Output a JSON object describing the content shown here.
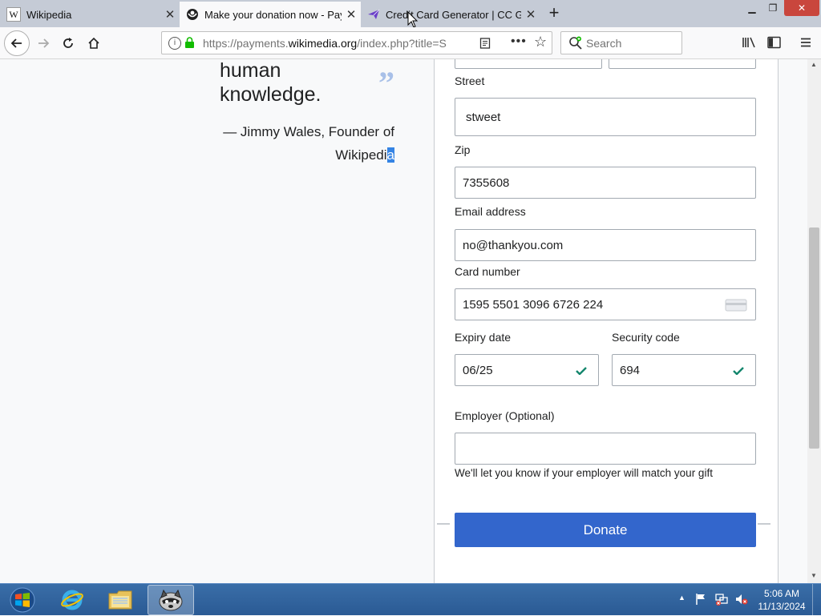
{
  "browser": {
    "tabs": [
      {
        "title": "Wikipedia",
        "icon": "wikipedia-icon"
      },
      {
        "title": "Make your donation now - Pay",
        "icon": "wikimedia-icon"
      },
      {
        "title": "Credit Card Generator | CC Ger",
        "icon": "paper-plane-icon"
      }
    ],
    "url_prefix": "https://payments.",
    "url_domain": "wikimedia.org",
    "url_path": "/index.php?title=S",
    "search_placeholder": "Search",
    "window_controls": {
      "minimize": "▁",
      "restore": "❐",
      "close": "✕"
    }
  },
  "quote": {
    "line1": "human",
    "line2": "knowledge.",
    "quote_mark": "”",
    "attribution_line1": "— Jimmy Wales, Founder of",
    "attribution_line2_plain": "Wikipedi",
    "attribution_line2_selected": "a"
  },
  "form": {
    "street_label": "Street",
    "street_value": "stweet",
    "zip_label": "Zip",
    "zip_value": "7355608",
    "email_label": "Email address",
    "email_value": "no@thankyou.com",
    "card_label": "Card number",
    "card_value": "1595 5501 3096 6726 224",
    "expiry_label": "Expiry date",
    "expiry_value": "06/25",
    "security_label": "Security code",
    "security_value": "694",
    "employer_label": "Employer (Optional)",
    "employer_value": "",
    "employer_note": "We'll let you know if your employer will match your gift",
    "donate_label": "Donate"
  },
  "colors": {
    "donate_button": "#3366cc",
    "check_green": "#14866d",
    "selection": "#3584e4",
    "taskbar": "#2a5a94"
  },
  "taskbar": {
    "time": "5:06 AM",
    "date": "11/13/2024"
  }
}
